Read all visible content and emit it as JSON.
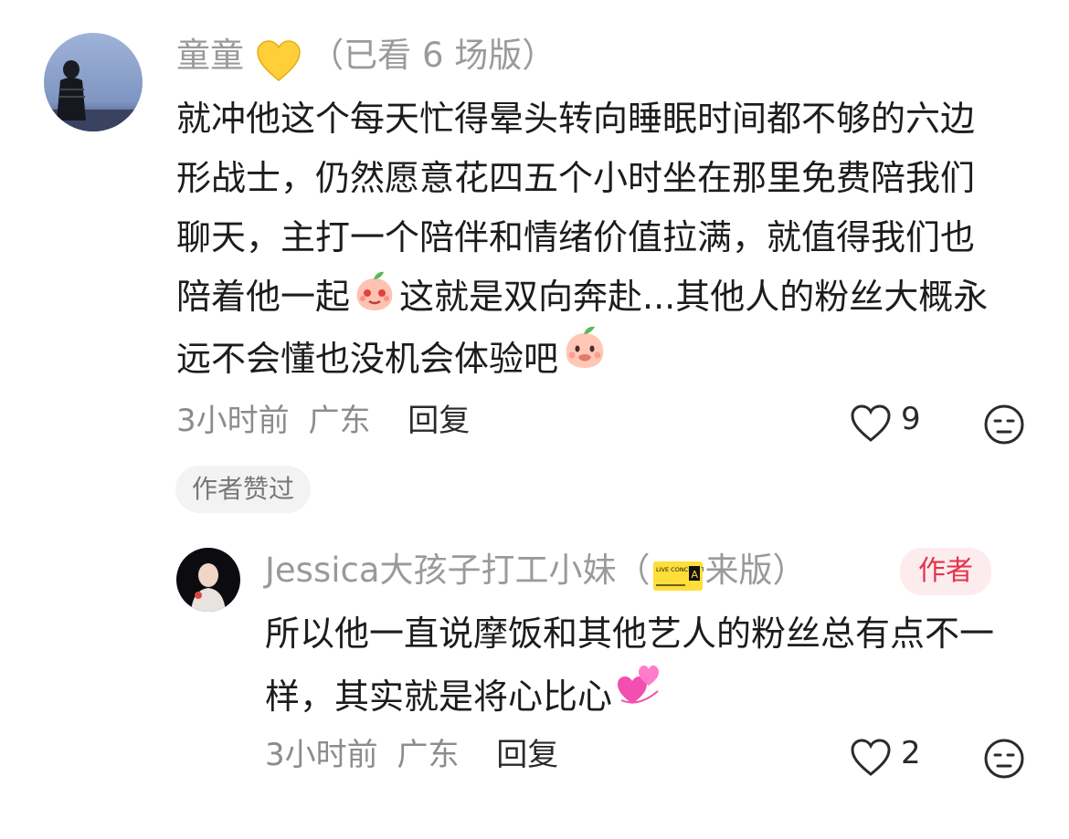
{
  "comment": {
    "username": "童童",
    "tag": "（已看 6 场版）",
    "text_part1": "就冲他这个每天忙得晕头转向睡眠时间都不够的六边形战士，仍然愿意花四五个小时坐在那里免费陪我们聊天，主打一个陪伴和情绪价值拉满，就值得我们也陪着他一起",
    "text_part2": "这就是双向奔赴...其他人的粉丝大概永远不会懂也没机会体验吧",
    "time": "3小时前",
    "location": "广东",
    "reply_label": "回复",
    "like_count": "9",
    "author_liked_label": "作者赞过"
  },
  "reply": {
    "username": "Jessica大孩子打工小妹",
    "tag_open": "（",
    "tag_close": "来版）",
    "ticket_text": "LIVE CONCERT TICKET",
    "author_badge": "作者",
    "text": "所以他一直说摩饭和其他艺人的粉丝总有点不一样，其实就是将心比心",
    "time": "3小时前",
    "location": "广东",
    "reply_label": "回复",
    "like_count": "2"
  },
  "icons": {
    "heart": "heart-outline-icon",
    "face": "neutral-face-icon",
    "yellow_heart": "yellow-heart-emoji",
    "peach_excited": "peach-excited-emoji",
    "peach_shy": "peach-shy-emoji",
    "two_hearts": "revolving-hearts-emoji"
  },
  "colors": {
    "username": "#9a9a9a",
    "body": "#1c1c1c",
    "meta": "#8c8c8c",
    "author_badge_bg": "#fdecee",
    "author_badge_text": "#e2334e"
  }
}
